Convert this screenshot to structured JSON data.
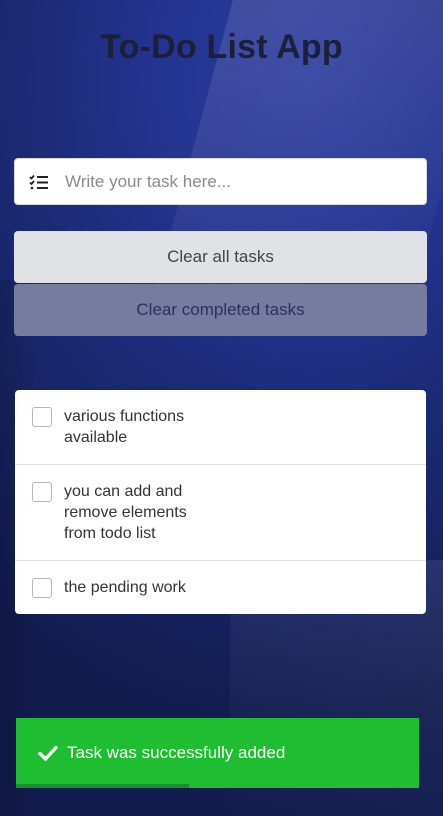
{
  "app": {
    "title": "To-Do List App"
  },
  "input": {
    "placeholder": "Write your task here...",
    "value": "",
    "icon": "task-list-icon"
  },
  "buttons": {
    "clear_all": "Clear all tasks",
    "clear_completed": "Clear completed tasks"
  },
  "tasks": [
    {
      "text": "various functions available",
      "completed": false
    },
    {
      "text": "you can add and remove elements from todo list",
      "completed": false
    },
    {
      "text": "the pending work",
      "completed": false
    }
  ],
  "toast": {
    "message": "Task was successfully added",
    "icon": "check-icon",
    "progress": 0.43,
    "color": "#1fbd32"
  }
}
